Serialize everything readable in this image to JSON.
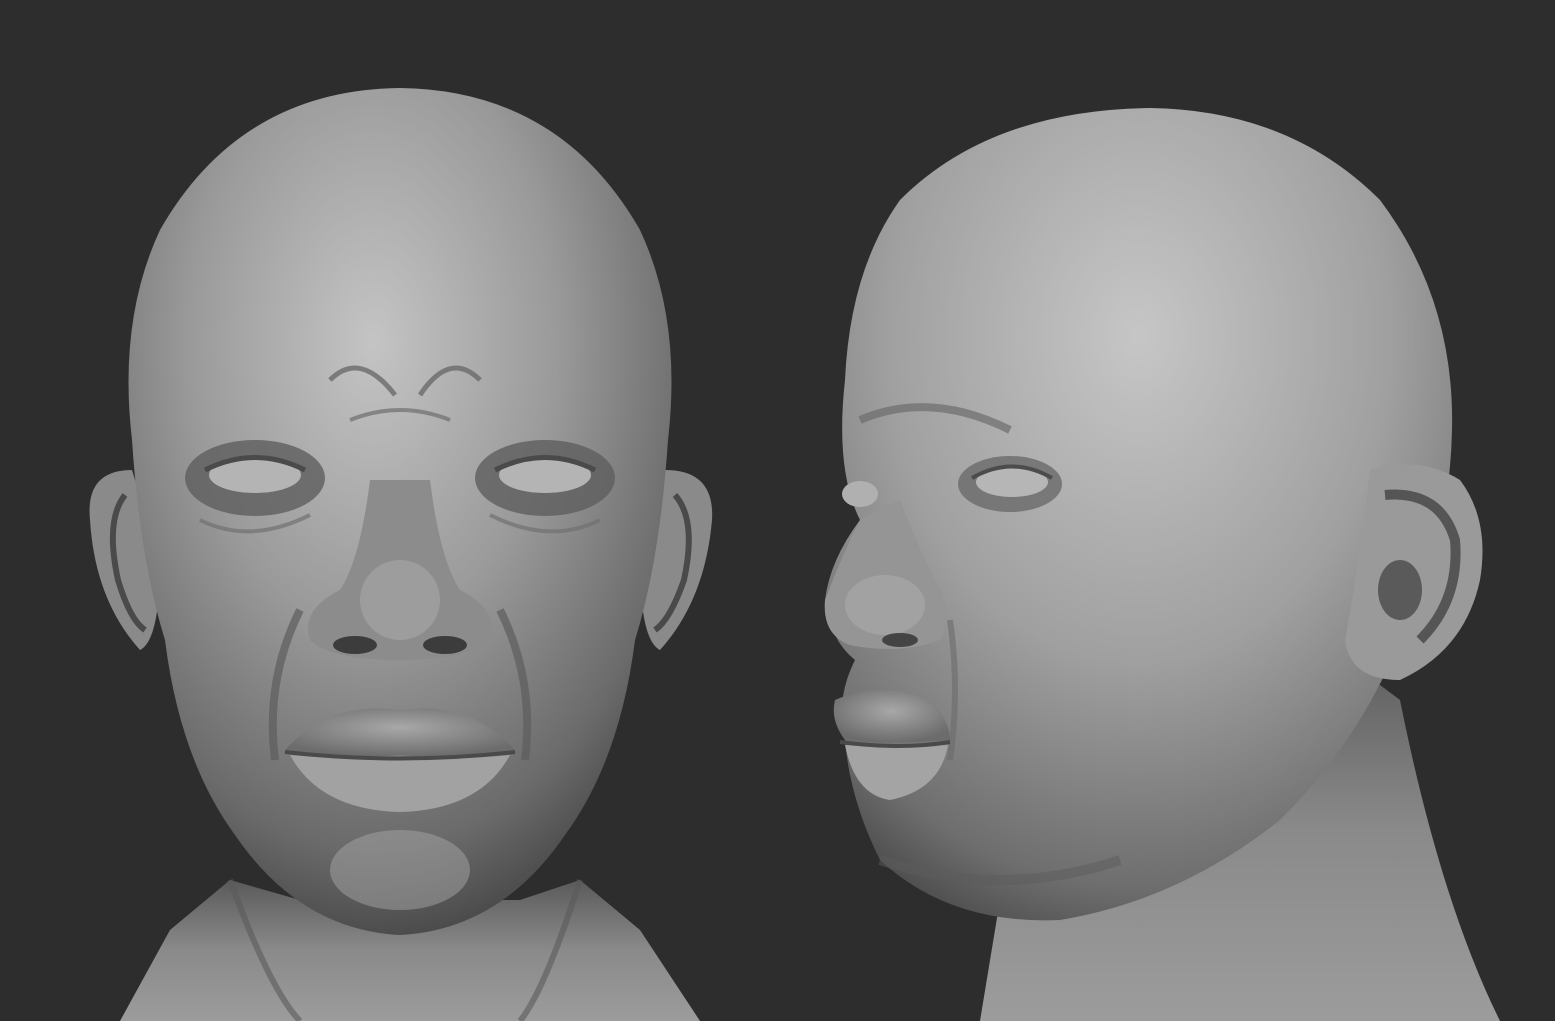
{
  "scene": {
    "background_color": "#2d2d2d",
    "clay_light": "#bdbdbd",
    "clay_mid": "#8e8e8e",
    "clay_dark": "#4a4a4a",
    "views": [
      {
        "name": "front-view",
        "subject": "sculpted-head"
      },
      {
        "name": "three-quarter-view",
        "subject": "sculpted-head"
      }
    ]
  }
}
